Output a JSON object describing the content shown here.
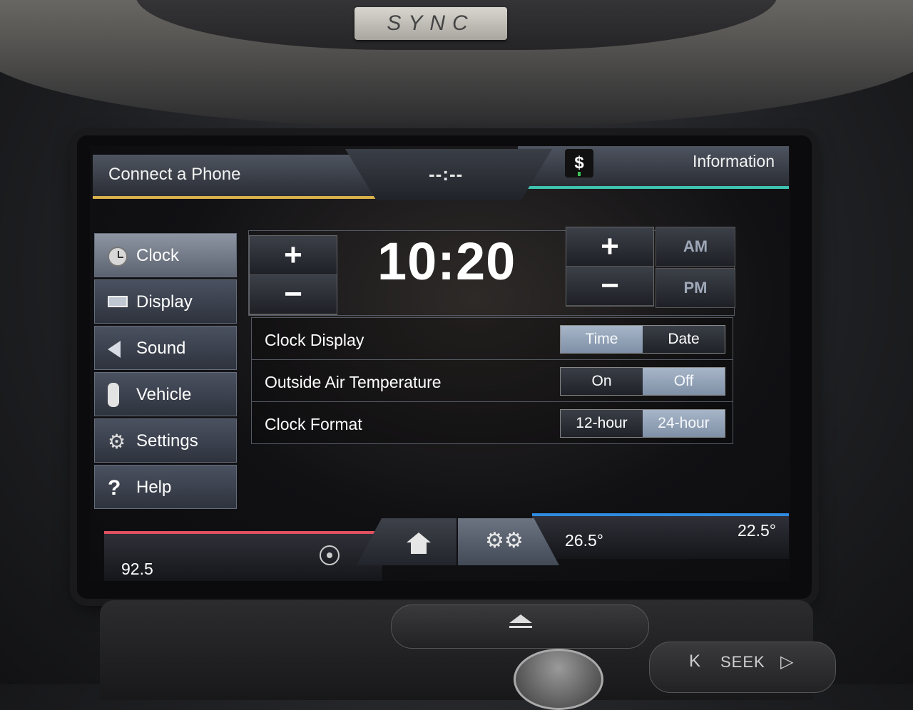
{
  "bezel": {
    "logo": "SYNC"
  },
  "topbar": {
    "phone": "Connect a Phone",
    "time": "--:--",
    "currency_icon": "$",
    "information": "Information"
  },
  "sidebar": {
    "items": [
      {
        "label": "Clock",
        "icon": "clock-icon",
        "active": true
      },
      {
        "label": "Display",
        "icon": "display-icon"
      },
      {
        "label": "Sound",
        "icon": "speaker-icon"
      },
      {
        "label": "Vehicle",
        "icon": "car-icon"
      },
      {
        "label": "Settings",
        "icon": "gear-icon"
      },
      {
        "label": "Help",
        "icon": "help-icon"
      }
    ]
  },
  "clock": {
    "time": "10:20",
    "plus": "+",
    "minus": "−",
    "am": "AM",
    "pm": "PM"
  },
  "settings": {
    "rows": [
      {
        "label": "Clock Display",
        "options": [
          "Time",
          "Date"
        ],
        "selected": "Time"
      },
      {
        "label": "Outside Air Temperature",
        "options": [
          "On",
          "Off"
        ],
        "selected": "Off"
      },
      {
        "label": "Clock Format",
        "options": [
          "12-hour",
          "24-hour"
        ],
        "selected": "24-hour"
      }
    ]
  },
  "bottombar": {
    "frequency": "92.5",
    "temp_driver": "26.5°",
    "temp_passenger": "22.5°",
    "gear_glyph": "⚙⚙"
  },
  "console": {
    "seek": "SEEK",
    "seek_prev": "K",
    "seek_next": "▷"
  },
  "colors": {
    "phone_accent": "#d8b14a",
    "info_accent": "#3ec3b0",
    "radio_accent": "#e05060",
    "climate_accent": "#2f8be0"
  }
}
